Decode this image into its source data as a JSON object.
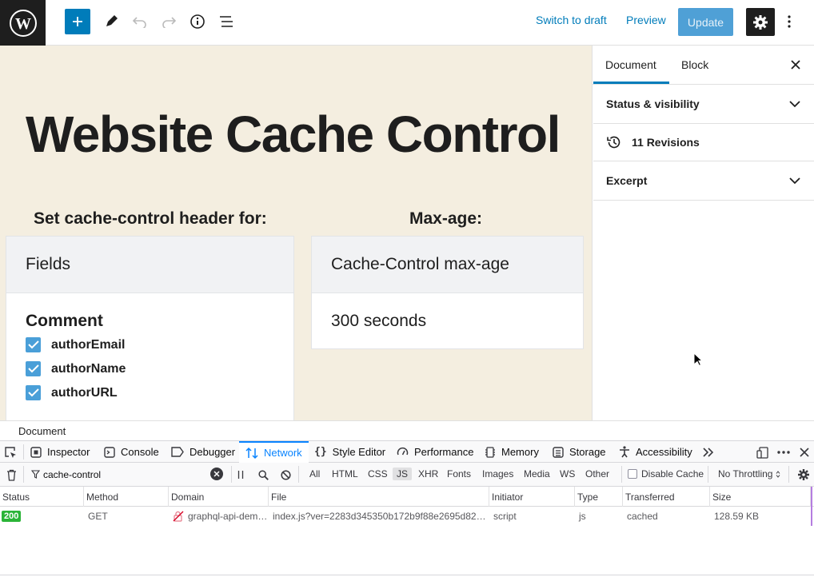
{
  "toolbar": {
    "switch_to_draft": "Switch to draft",
    "preview": "Preview",
    "update": "Update",
    "icons": [
      "wordpress-logo",
      "plus-icon",
      "pencil-icon",
      "undo-icon",
      "redo-icon",
      "info-icon",
      "list-view-icon",
      "gear-icon",
      "kebab-icon"
    ],
    "colors": {
      "accent": "#007cba",
      "update_bg": "#4fa0d6",
      "dark": "#1e1e1e"
    }
  },
  "canvas": {
    "title": "Website Cache Control",
    "background": "#f4eee0",
    "left_column": {
      "heading": "Set cache-control header for:",
      "card_header": "Fields",
      "group_title": "Comment",
      "fields": [
        "authorEmail",
        "authorName",
        "authorURL"
      ]
    },
    "right_column": {
      "heading": "Max-age:",
      "card_header": "Cache-Control max-age",
      "value": "300 seconds"
    }
  },
  "sidebar": {
    "tabs": [
      "Document",
      "Block"
    ],
    "active_tab": "Document",
    "panels": {
      "status_visibility": "Status & visibility",
      "revisions": "11 Revisions",
      "excerpt": "Excerpt"
    }
  },
  "breadcrumb": {
    "label": "Document"
  },
  "devtools": {
    "tabs": [
      "Inspector",
      "Console",
      "Debugger",
      "Network",
      "Style Editor",
      "Performance",
      "Memory",
      "Storage",
      "Accessibility"
    ],
    "active_tab": "Network",
    "filter": {
      "value": "cache-control",
      "types": [
        "All",
        "HTML",
        "CSS",
        "JS",
        "XHR",
        "Fonts",
        "Images",
        "Media",
        "WS",
        "Other"
      ],
      "selected_type": "JS",
      "disable_cache": "Disable Cache",
      "throttling": "No Throttling"
    },
    "columns": [
      "Status",
      "Method",
      "Domain",
      "File",
      "Initiator",
      "Type",
      "Transferred",
      "Size"
    ],
    "rows": [
      {
        "status": "200",
        "method": "GET",
        "domain": "graphql-api-dem…",
        "file": "index.js?ver=2283d345350b172b9f88e2695d82…",
        "initiator": "script",
        "type": "js",
        "transferred": "cached",
        "size": "128.59 KB"
      }
    ],
    "colors": {
      "active": "#0a84ff",
      "status_ok": "#2bb438"
    }
  }
}
